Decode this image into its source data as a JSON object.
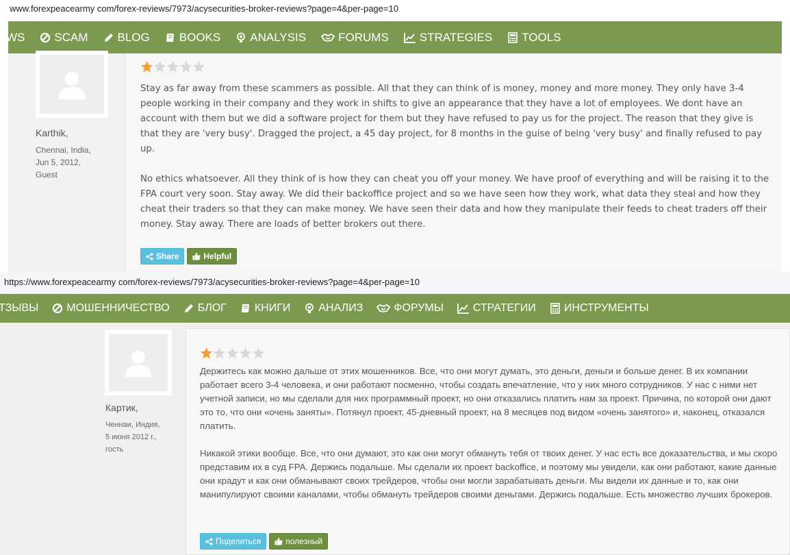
{
  "colors": {
    "nav_bg": "#7b9a50",
    "share_btn": "#5bc0de",
    "helpful_btn": "#6f8f40",
    "star_active": "#f0a030",
    "star_inactive": "#d8d8d8"
  },
  "english": {
    "url": "www.forexpeacearmy com/forex-reviews/7973/acysecurities-broker-reviews?page=4&per-page=10",
    "nav": [
      {
        "label": "WS",
        "icon": "none"
      },
      {
        "label": "SCAM",
        "icon": "ban-icon"
      },
      {
        "label": "BLOG",
        "icon": "pencil-icon"
      },
      {
        "label": "BOOKS",
        "icon": "book-icon"
      },
      {
        "label": "ANALYSIS",
        "icon": "lightbulb-icon"
      },
      {
        "label": "FORUMS",
        "icon": "handshake-icon"
      },
      {
        "label": "STRATEGIES",
        "icon": "line-chart-icon"
      },
      {
        "label": "TOOLS",
        "icon": "calculator-icon"
      }
    ],
    "author": {
      "name": "Karthik,",
      "location": "Chennai, India,",
      "date": "Jun 5, 2012,",
      "role": "Guest"
    },
    "rating": 1,
    "max_rating": 5,
    "paragraphs": [
      "Stay as far away from these scammers as possible. All that they can think of is money, money and more money. They only have 3-4 people working in their company and they work in shifts to give an appearance that they have a lot of employees. We dont have an account with them but we did a software project for them but they have refused to pay us for the project. The reason that they give is that they are 'very busy'. Dragged the project, a 45 day project, for 8 months in the guise of being 'very busy' and finally refused to pay up.",
      "No ethics whatsoever. All they think of is how they can cheat you off your money. We have proof of everything and will be raising it to the FPA court very soon. Stay away. We did their backoffice project and so we have seen how they work, what data they steal and how they cheat their traders so that they can make money. We have seen their data and how they manipulate their feeds to cheat traders off their money. Stay away. There are loads of better brokers out there."
    ],
    "share_label": "Share",
    "helpful_label": "Helpful"
  },
  "russian": {
    "url": "https://www.forexpeacearmy com/forex-reviews/7973/acysecurities-broker-reviews?page=4&per-page=10",
    "nav": [
      {
        "label": "ТЗЫВЫ",
        "icon": "none"
      },
      {
        "label": "МОШЕННИЧЕСТВО",
        "icon": "ban-icon"
      },
      {
        "label": "БЛОГ",
        "icon": "pencil-icon"
      },
      {
        "label": "КНИГИ",
        "icon": "book-icon"
      },
      {
        "label": "АНАЛИЗ",
        "icon": "lightbulb-icon"
      },
      {
        "label": "ФОРУМЫ",
        "icon": "handshake-icon"
      },
      {
        "label": "СТРАТЕГИИ",
        "icon": "line-chart-icon"
      },
      {
        "label": "ИНСТРУМЕНТЫ",
        "icon": "calculator-icon"
      }
    ],
    "author": {
      "name": "Картик,",
      "location": "Ченнаи, Индия,",
      "date": "5 июня 2012 г.,",
      "role": "гость"
    },
    "rating": 1,
    "max_rating": 5,
    "paragraphs": [
      "Держитесь как можно дальше от этих мошенников. Все, что они могут думать, это деньги, деньги и больше денег. В их компании работает всего 3-4 человека, и они работают посменно, чтобы создать впечатление, что у них много сотрудников. У нас с ними нет учетной записи, но мы сделали для них программный проект, но они отказались платить нам за проект. Причина, по которой они дают это то, что они «очень заняты». Потянул проект, 45-дневный проект, на 8 месяцев под видом «очень занятого» и, наконец, отказался платить.",
      "Никакой этики вообще. Все, что они думают, это как они могут обмануть тебя от твоих денег. У нас есть все доказательства, и мы скоро представим их в суд FPA. Держись подальше. Мы сделали их проект backoffice, и поэтому мы увидели, как они работают, какие данные они крадут и как они обманывают своих трейдеров, чтобы они могли зарабатывать деньги. Мы видели их данные и то, как они манипулируют своими каналами, чтобы обмануть трейдеров своими деньгами. Держись подальше. Есть множество лучших брокеров."
    ],
    "share_label": "Поделиться",
    "helpful_label": "полезный"
  }
}
